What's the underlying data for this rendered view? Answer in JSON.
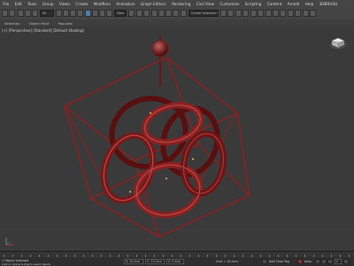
{
  "menu": [
    "File",
    "Edit",
    "Tools",
    "Group",
    "Views",
    "Create",
    "Modifiers",
    "Animation",
    "Graph Editors",
    "Rendering",
    "Civil View",
    "Customize",
    "Scripting",
    "Content",
    "Arnold",
    "Help",
    "3DBRUSH"
  ],
  "toolbar": {
    "selection_filter": "All",
    "view_dropdown": "View",
    "named_selection": "Create Selection Se",
    "snap_value": "3"
  },
  "ribbon": {
    "tabs": [
      "Selection",
      "Object Paint",
      "Populate"
    ]
  },
  "viewport": {
    "label": "[+] [Perspective] [Standard] [Default Shading]",
    "viewcube_label": "",
    "buttons": [
      "Sp",
      "Vp"
    ]
  },
  "colors": {
    "wire": "#9b1b1b",
    "object_dark": "#5a0f0f",
    "object_light": "#b84a4a",
    "viewport_bg": "#3a3a3a"
  },
  "status": {
    "left_text": "1 Object Selected",
    "prompt": "Click or click-and-drag to select objects",
    "coords": {
      "x": "X: 20.0cm",
      "y": "Y: -10.0cm",
      "z": "Z: 0.0cm"
    },
    "grid": "Grid = 10.0cm",
    "add_time_tag": "Add Time Tag",
    "auto_label": "Auto",
    "frame": "0"
  }
}
